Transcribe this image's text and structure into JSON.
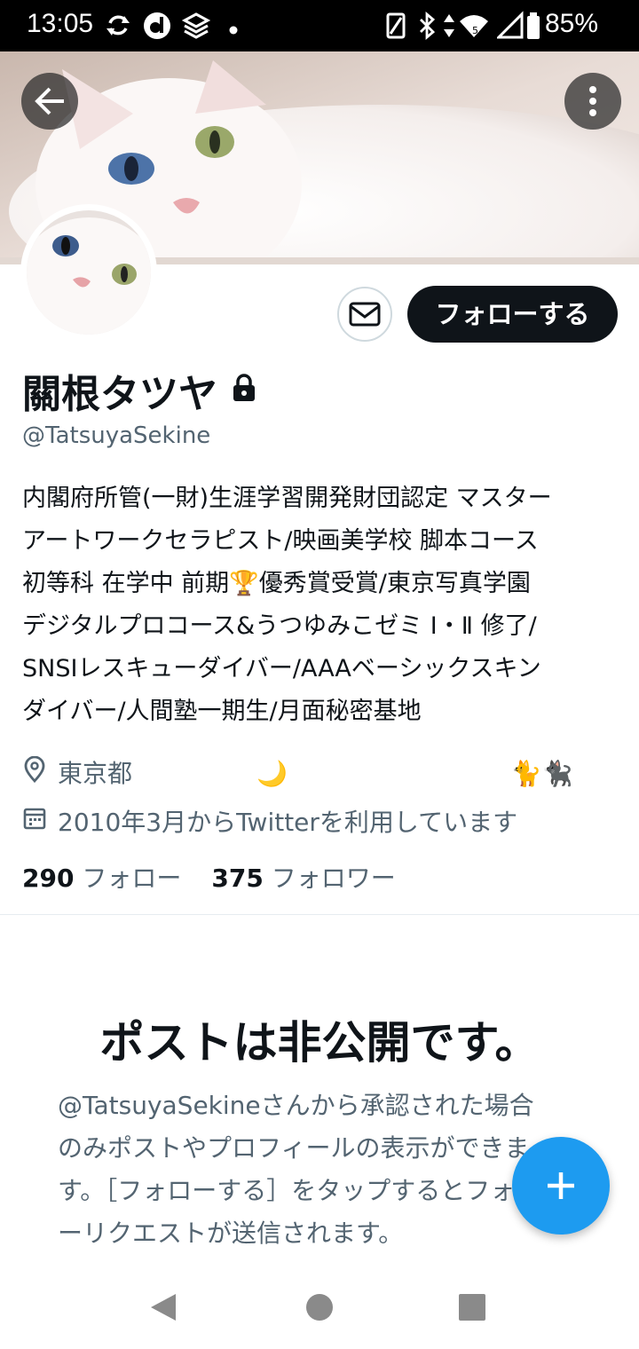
{
  "status_bar": {
    "time": "13:05",
    "battery_percent": "85%",
    "icons_left": [
      "sync-icon",
      "d-app-icon",
      "layers-icon",
      "dot-icon"
    ],
    "icons_right": [
      "vibrate-icon",
      "bluetooth-icon",
      "data-arrows-icon",
      "wifi-icon",
      "signal-icon",
      "battery-icon"
    ]
  },
  "header": {
    "back_icon": "arrow-left-icon",
    "more_icon": "more-vertical-icon"
  },
  "profile": {
    "display_name": "關根タツヤ",
    "protected_icon": "lock-icon",
    "handle": "@TatsuyaSekine",
    "bio_lines": [
      "内閣府所管(一財)生涯学習開発財団認定 マスター",
      "アートワークセラピスト/映画美学校 脚本コース",
      "初等科 在学中 前期🏆優秀賞受賞/東京写真学園",
      "デジタルプロコース&うつゆみこゼミ Ⅰ・Ⅱ 修了/",
      "SNSIレスキューダイバー/AAAベーシックスキン",
      "ダイバー/人間塾一期生/月面秘密基地"
    ],
    "location": "東京都　　　　　🌙　　　　　　　　　🐈🐈‍⬛",
    "joined": "2010年3月からTwitterを利用しています",
    "following_count": "290",
    "following_label": "フォロー",
    "followers_count": "375",
    "followers_label": "フォロワー"
  },
  "actions": {
    "message_icon": "envelope-icon",
    "follow_label": "フォローする"
  },
  "protected_notice": {
    "title": "ポストは非公開です。",
    "description_lines": [
      "@TatsuyaSekineさんから承認された場合",
      "のみポストやプロフィールの表示ができま",
      "す。［フォローする］をタップするとフォロ",
      "ーリクエストが送信されます。"
    ]
  },
  "fab": {
    "icon": "plus-icon"
  },
  "nav_bar": {
    "back_icon": "nav-back-icon",
    "home_icon": "nav-home-icon",
    "recents_icon": "nav-recents-icon"
  },
  "colors": {
    "accent": "#1d9bf0",
    "text_primary": "#0f1419",
    "text_secondary": "#536471",
    "button_dark": "#0f1419"
  }
}
